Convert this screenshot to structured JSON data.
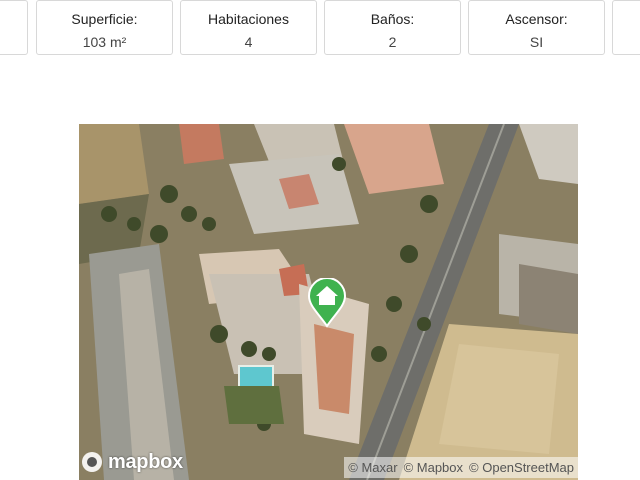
{
  "stats": [
    {
      "label": "",
      "value": ""
    },
    {
      "label": "Superficie:",
      "value": "103 m²"
    },
    {
      "label": "Habitaciones",
      "value": "4"
    },
    {
      "label": "Baños:",
      "value": "2"
    },
    {
      "label": "Ascensor:",
      "value": "SI"
    },
    {
      "label": "",
      "value": ""
    }
  ],
  "map": {
    "logo_text": "mapbox",
    "marker_icon": "home-icon",
    "marker_color": "#3fb24f",
    "attribution": [
      "© Maxar",
      "© Mapbox",
      "© OpenStreetMap"
    ]
  }
}
